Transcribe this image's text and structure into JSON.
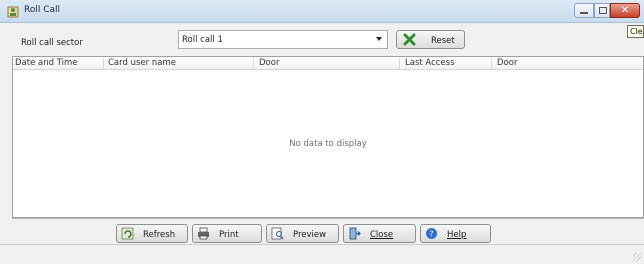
{
  "window": {
    "title": "Roll Call",
    "icons": {
      "app": "roll-call-icon",
      "minimize": "minimize-icon",
      "maximize": "maximize-icon",
      "close": "close-x-icon"
    },
    "close_glyph": "✕",
    "tooltip_fragment": "Cle"
  },
  "sector": {
    "label": "Roll call sector",
    "selected": "Roll call 1",
    "reset_label": "Reset",
    "reset_icon": "x-mark-icon"
  },
  "table": {
    "columns": [
      "Date and Time",
      "Card user name",
      "Door",
      "Last Access",
      "Door"
    ],
    "empty_text": "No data to display"
  },
  "buttons": {
    "refresh": {
      "label": "Refresh",
      "icon": "refresh-icon"
    },
    "print": {
      "label": "Print",
      "icon": "printer-icon"
    },
    "preview": {
      "label": "Preview",
      "icon": "preview-icon"
    },
    "close": {
      "label": "Close",
      "icon": "exit-door-icon"
    },
    "help": {
      "label": "Help",
      "icon": "help-icon"
    }
  },
  "colors": {
    "reset_icon": "#2e8b2e",
    "help_icon": "#2f6fd0",
    "close_button": "#c7402b"
  }
}
